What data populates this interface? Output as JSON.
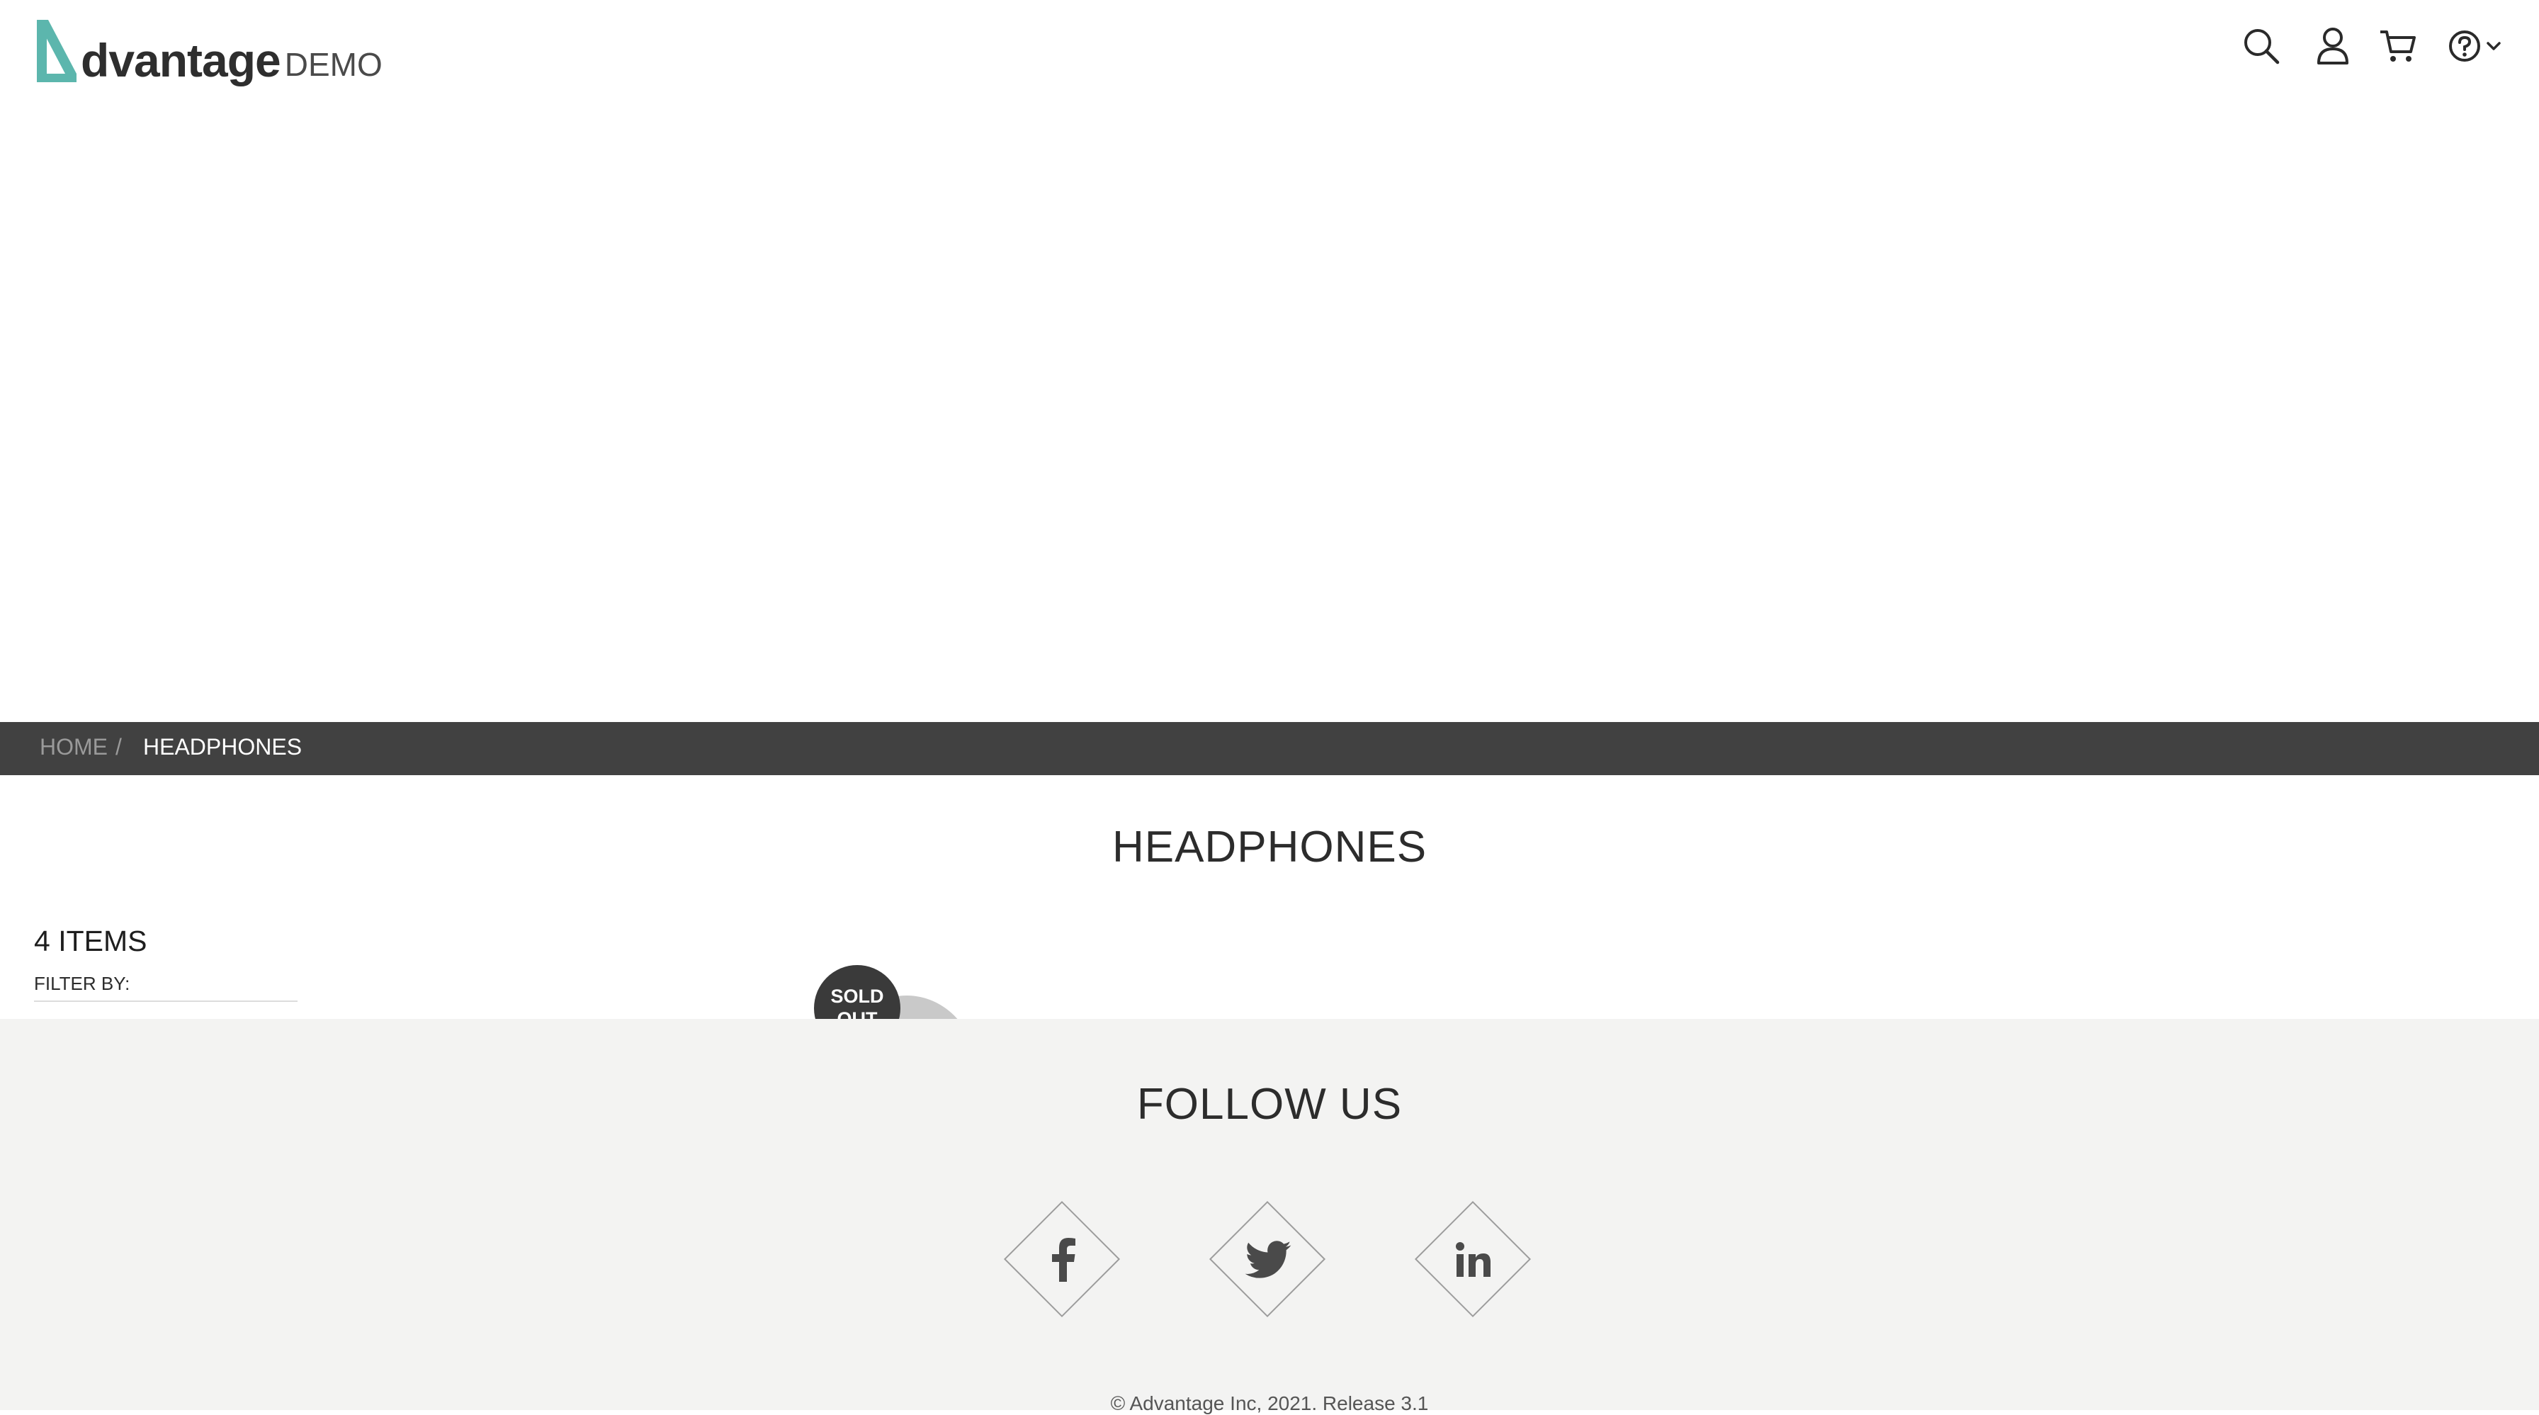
{
  "header": {
    "logo": {
      "brand_text": "dvantage",
      "demo_text": "DEMO",
      "accent": "#5cb6ad"
    },
    "icons": [
      "search-icon",
      "user-icon",
      "cart-icon",
      "help-icon",
      "chevron-down-icon"
    ]
  },
  "breadcrumb": {
    "home": "HOME",
    "separator": "/",
    "current": "HEADPHONES"
  },
  "main": {
    "title": "HEADPHONES",
    "items_count": "4 ITEMS",
    "filter_label": "FILTER BY:",
    "product_badge": "SOLD OUT"
  },
  "footer": {
    "follow_title": "FOLLOW US",
    "social": [
      "facebook-icon",
      "twitter-icon",
      "linkedin-icon"
    ],
    "copyright": "© Advantage Inc, 2021. Release 3.1"
  },
  "colors": {
    "breadcrumb_bg": "#414141",
    "footer_bg": "#f3f3f2",
    "badge_bg": "#3a3a3a"
  }
}
